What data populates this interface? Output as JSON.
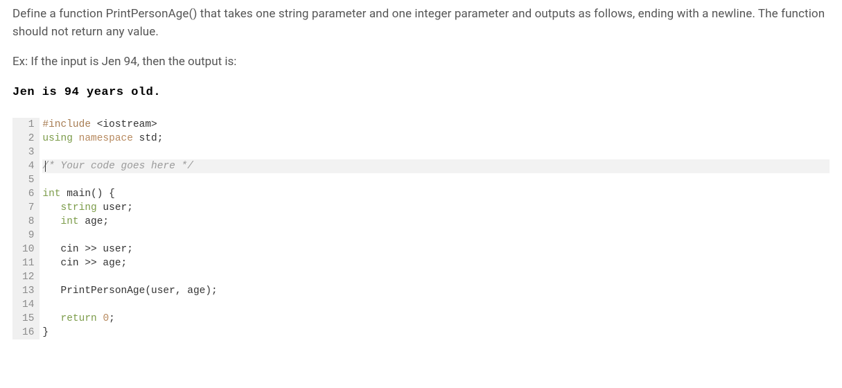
{
  "problem": {
    "description": "Define a function PrintPersonAge() that takes one string parameter and one integer parameter and outputs as follows, ending with a newline. The function should not return any value.",
    "example_intro": "Ex: If the input is Jen 94, then the output is:",
    "example_output": "Jen is 94 years old."
  },
  "editor": {
    "active_line": 4,
    "lines": [
      {
        "n": 1,
        "tokens": [
          {
            "t": "#include",
            "c": "tok-preproc"
          },
          {
            "t": " "
          },
          {
            "t": "<iostream>",
            "c": "tok-include-file"
          }
        ]
      },
      {
        "n": 2,
        "tokens": [
          {
            "t": "using",
            "c": "tok-using"
          },
          {
            "t": " "
          },
          {
            "t": "namespace",
            "c": "tok-namespace"
          },
          {
            "t": " "
          },
          {
            "t": "std",
            "c": "tok-std"
          },
          {
            "t": ";",
            "c": "tok-punct"
          }
        ]
      },
      {
        "n": 3,
        "tokens": []
      },
      {
        "n": 4,
        "tokens": [
          {
            "t": "/* Your code goes here */",
            "c": "tok-comment"
          }
        ]
      },
      {
        "n": 5,
        "tokens": []
      },
      {
        "n": 6,
        "tokens": [
          {
            "t": "int",
            "c": "tok-type"
          },
          {
            "t": " "
          },
          {
            "t": "main",
            "c": "tok-func"
          },
          {
            "t": "()",
            "c": "tok-paren"
          },
          {
            "t": " {",
            "c": "tok-punct"
          }
        ]
      },
      {
        "n": 7,
        "tokens": [
          {
            "t": "   "
          },
          {
            "t": "string",
            "c": "tok-type"
          },
          {
            "t": " user;",
            "c": "tok-std"
          }
        ]
      },
      {
        "n": 8,
        "tokens": [
          {
            "t": "   "
          },
          {
            "t": "int",
            "c": "tok-type"
          },
          {
            "t": " age;",
            "c": "tok-std"
          }
        ]
      },
      {
        "n": 9,
        "tokens": []
      },
      {
        "n": 10,
        "tokens": [
          {
            "t": "   cin "
          },
          {
            "t": ">>",
            "c": "tok-op"
          },
          {
            "t": " user;"
          }
        ]
      },
      {
        "n": 11,
        "tokens": [
          {
            "t": "   cin "
          },
          {
            "t": ">>",
            "c": "tok-op"
          },
          {
            "t": " age;"
          }
        ]
      },
      {
        "n": 12,
        "tokens": []
      },
      {
        "n": 13,
        "tokens": [
          {
            "t": "   PrintPersonAge(user, age);"
          }
        ]
      },
      {
        "n": 14,
        "tokens": []
      },
      {
        "n": 15,
        "tokens": [
          {
            "t": "   "
          },
          {
            "t": "return",
            "c": "tok-keyword"
          },
          {
            "t": " "
          },
          {
            "t": "0",
            "c": "tok-num"
          },
          {
            "t": ";"
          }
        ]
      },
      {
        "n": 16,
        "tokens": [
          {
            "t": "}",
            "c": "tok-punct"
          }
        ]
      }
    ]
  }
}
